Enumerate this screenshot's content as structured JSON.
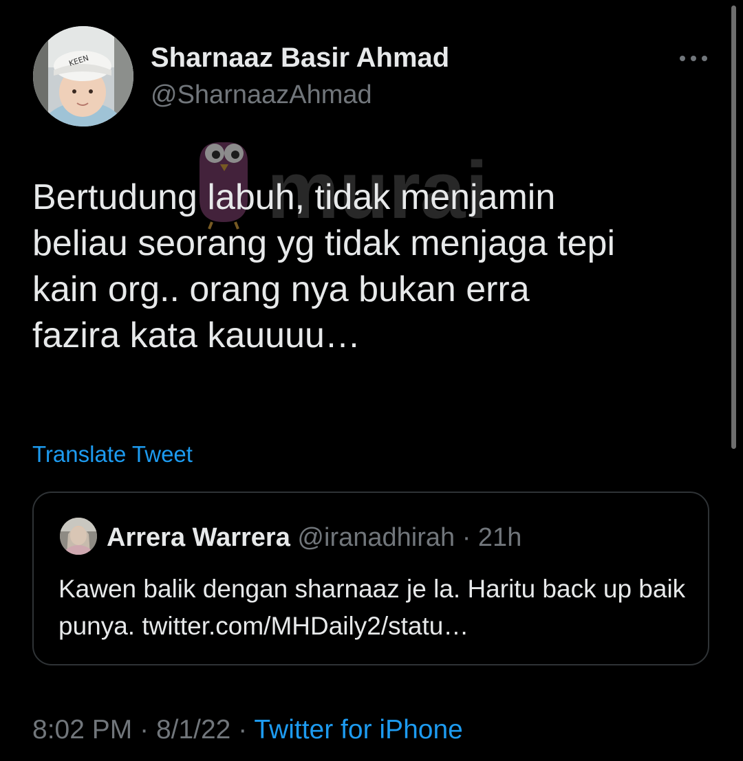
{
  "tweet": {
    "display_name": "Sharnaaz Basir Ahmad",
    "handle": "@SharnaazAhmad",
    "text": "Bertudung labuh, tidak menjamin\nbeliau seorang yg tidak menjaga tepi\nkain org.. orang nya bukan erra\nfazira kata kauuuu…",
    "translate_label": "Translate Tweet",
    "time": "8:02 PM",
    "separator": "·",
    "date": "8/1/22",
    "source": "Twitter for iPhone",
    "avatar_cap_text": "KEEN"
  },
  "quoted_tweet": {
    "display_name": "Arrera Warrera",
    "handle": "@iranadhirah",
    "separator": "·",
    "time_ago": "21h",
    "text": "Kawen balik dengan sharnaaz je la. Haritu back up baik punya. twitter.com/MHDaily2/statu…"
  },
  "watermark": {
    "text": "murai"
  },
  "colors": {
    "background": "#000000",
    "primary_text": "#e7e9ea",
    "secondary_text": "#71767b",
    "link": "#1d9bf0",
    "border": "#2f3336"
  },
  "icons": {
    "more": "more-horizontal-icon"
  }
}
